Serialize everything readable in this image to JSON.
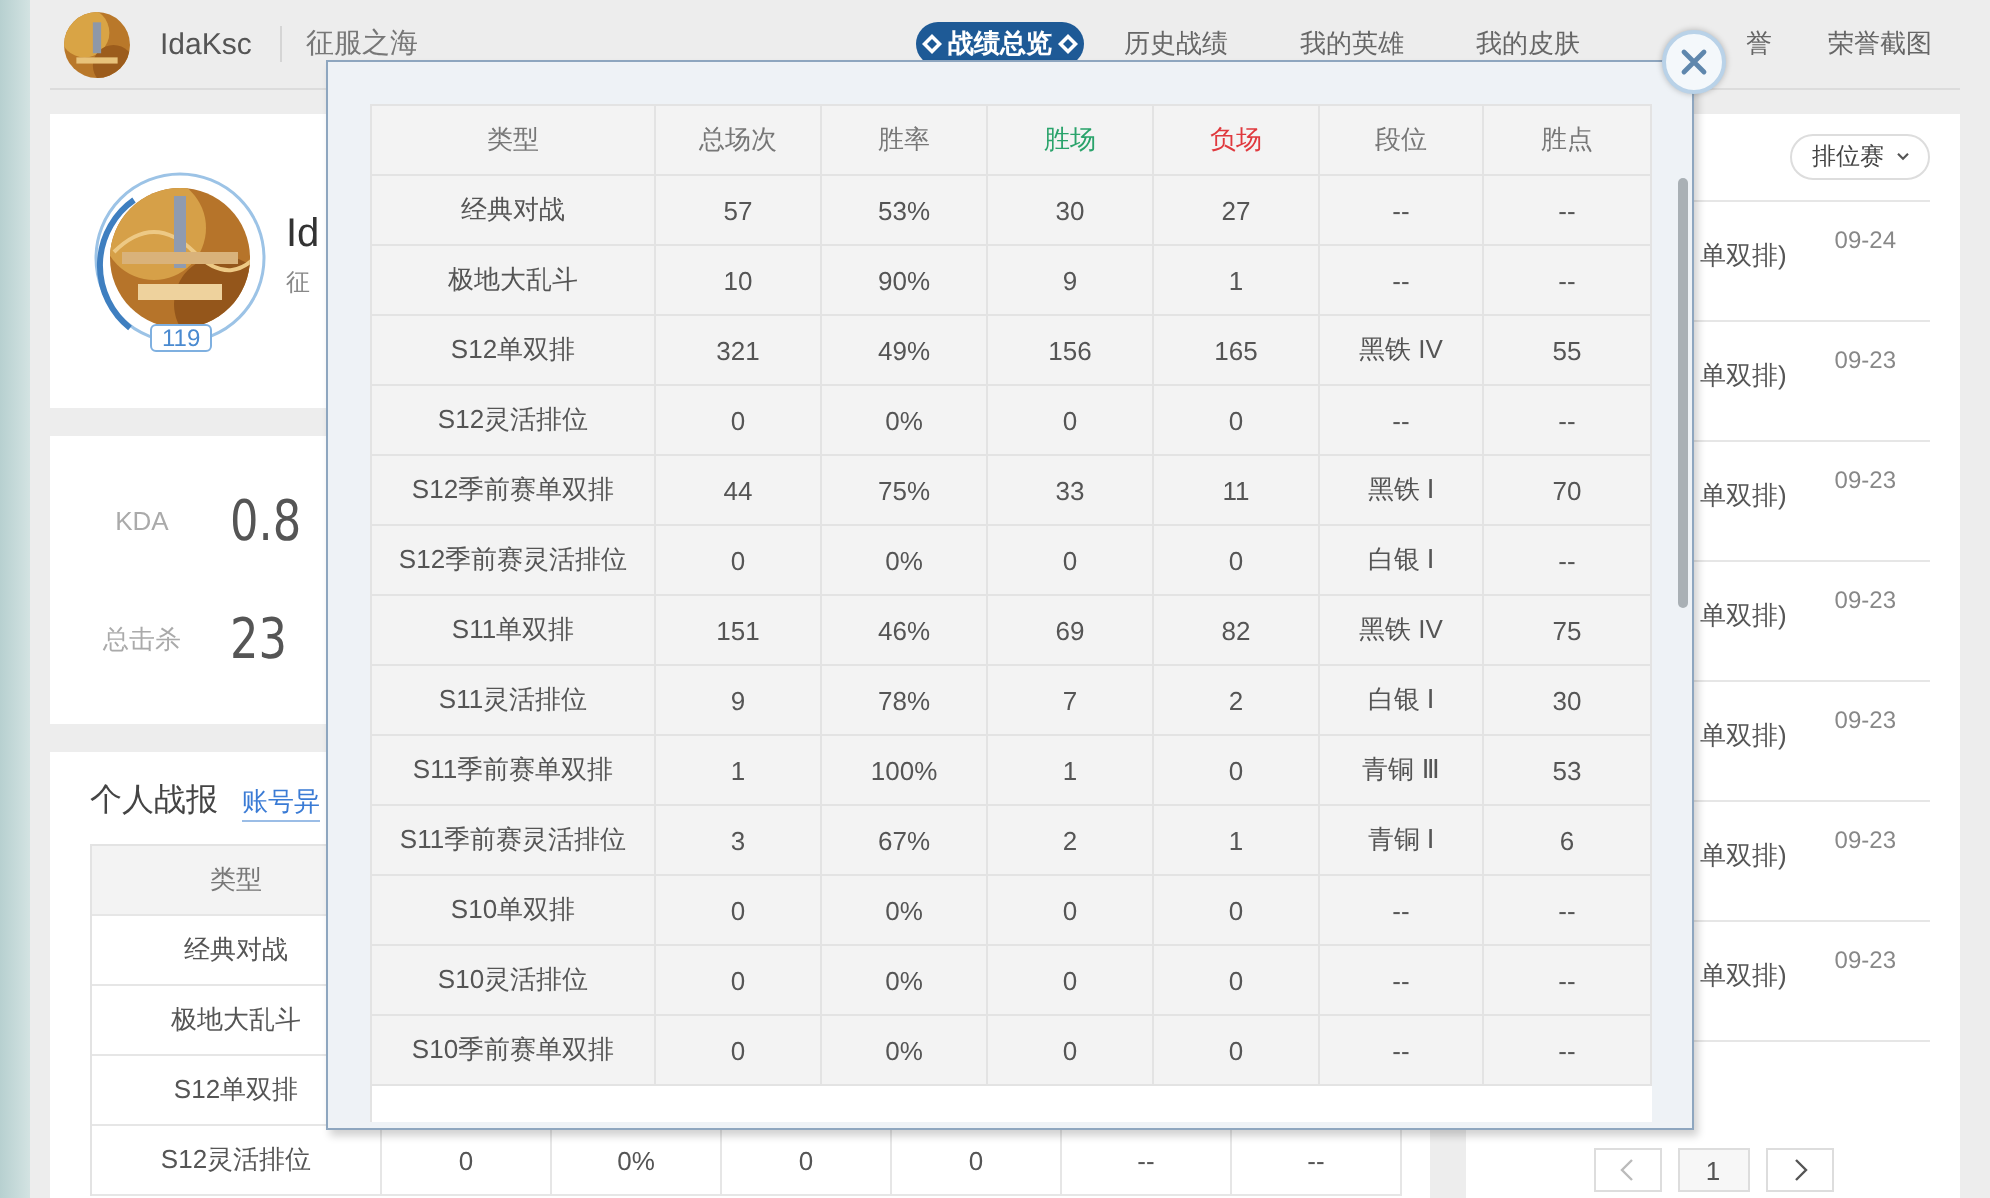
{
  "header": {
    "username": "IdaKsc",
    "server": "征服之海",
    "tabs": [
      {
        "label": "战绩总览",
        "selected": true
      },
      {
        "label": "历史战绩",
        "selected": false
      },
      {
        "label": "我的英雄",
        "selected": false
      },
      {
        "label": "我的皮肤",
        "selected": false
      },
      {
        "label": "誉",
        "selected": false
      },
      {
        "label": "荣誉截图",
        "selected": false
      }
    ]
  },
  "profile": {
    "name": "Id",
    "server": "征",
    "level": "119"
  },
  "stats": [
    {
      "label": "KDA",
      "value": "0.8"
    },
    {
      "label": "总击杀",
      "value": "23"
    }
  ],
  "report": {
    "title": "个人战报",
    "link": "账号异",
    "header": "类型",
    "rows": [
      {
        "type": "经典对战"
      },
      {
        "type": "极地大乱斗"
      },
      {
        "type": "S12单双排"
      },
      {
        "type": "S12灵活排位",
        "values": [
          "0",
          "0%",
          "0",
          "0",
          "--",
          "--"
        ]
      }
    ]
  },
  "history": {
    "filter": "排位赛",
    "items": [
      {
        "mode": "单双排)",
        "date": "09-24"
      },
      {
        "mode": "单双排)",
        "date": "09-23"
      },
      {
        "mode": "单双排)",
        "date": "09-23"
      },
      {
        "mode": "单双排)",
        "date": "09-23"
      },
      {
        "mode": "单双排)",
        "date": "09-23"
      },
      {
        "mode": "单双排)",
        "date": "09-23"
      },
      {
        "mode": "单双排)",
        "date": "09-23"
      }
    ],
    "page": "1"
  },
  "overview": {
    "columns": [
      {
        "label": "类型",
        "kind": "plain"
      },
      {
        "label": "总场次",
        "kind": "plain"
      },
      {
        "label": "胜率",
        "kind": "plain"
      },
      {
        "label": "胜场",
        "kind": "win"
      },
      {
        "label": "负场",
        "kind": "loss"
      },
      {
        "label": "段位",
        "kind": "plain"
      },
      {
        "label": "胜点",
        "kind": "plain"
      }
    ],
    "rows": [
      [
        "经典对战",
        "57",
        "53%",
        "30",
        "27",
        "--",
        "--"
      ],
      [
        "极地大乱斗",
        "10",
        "90%",
        "9",
        "1",
        "--",
        "--"
      ],
      [
        "S12单双排",
        "321",
        "49%",
        "156",
        "165",
        "黑铁 IV",
        "55"
      ],
      [
        "S12灵活排位",
        "0",
        "0%",
        "0",
        "0",
        "--",
        "--"
      ],
      [
        "S12季前赛单双排",
        "44",
        "75%",
        "33",
        "11",
        "黑铁 Ⅰ",
        "70"
      ],
      [
        "S12季前赛灵活排位",
        "0",
        "0%",
        "0",
        "0",
        "白银 Ⅰ",
        "--"
      ],
      [
        "S11单双排",
        "151",
        "46%",
        "69",
        "82",
        "黑铁 IV",
        "75"
      ],
      [
        "S11灵活排位",
        "9",
        "78%",
        "7",
        "2",
        "白银 Ⅰ",
        "30"
      ],
      [
        "S11季前赛单双排",
        "1",
        "100%",
        "1",
        "0",
        "青铜 Ⅲ",
        "53"
      ],
      [
        "S11季前赛灵活排位",
        "3",
        "67%",
        "2",
        "1",
        "青铜 Ⅰ",
        "6"
      ],
      [
        "S10单双排",
        "0",
        "0%",
        "0",
        "0",
        "--",
        "--"
      ],
      [
        "S10灵活排位",
        "0",
        "0%",
        "0",
        "0",
        "--",
        "--"
      ],
      [
        "S10季前赛单双排",
        "0",
        "0%",
        "0",
        "0",
        "--",
        "--"
      ]
    ]
  }
}
